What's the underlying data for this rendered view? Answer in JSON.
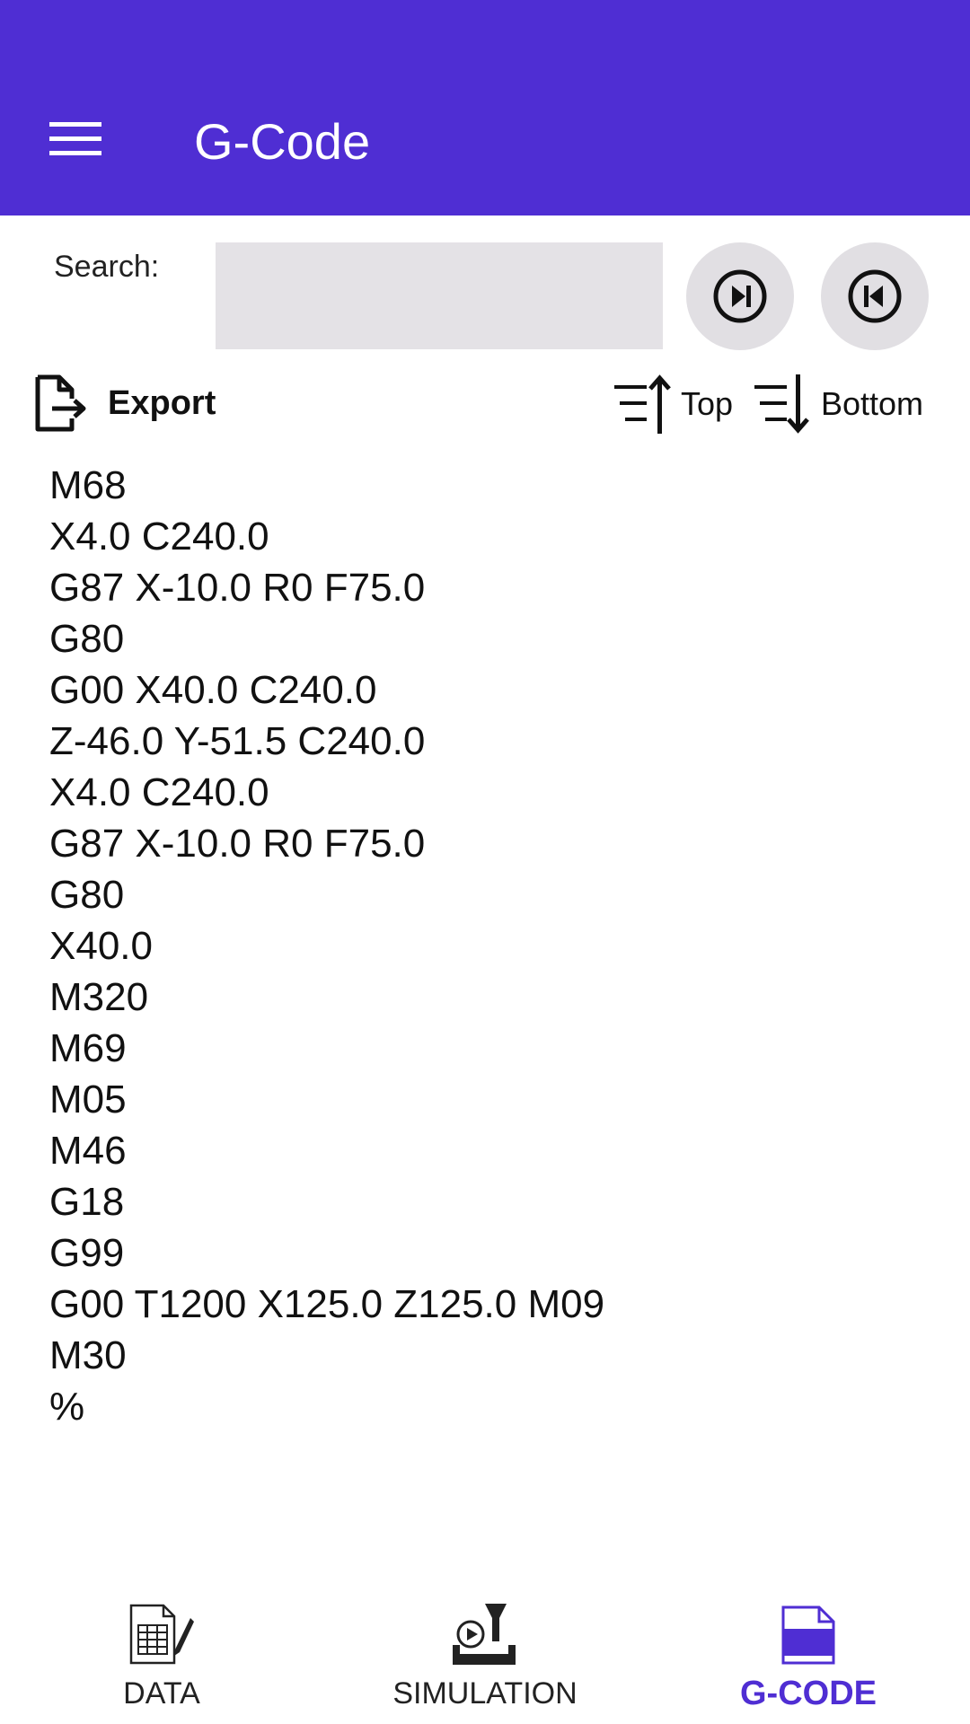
{
  "app_bar": {
    "title": "G-Code",
    "background": "#4f2ed3",
    "menu_icon": "hamburger-menu-icon"
  },
  "search": {
    "label": "Search:",
    "value": "",
    "placeholder": "",
    "next_icon": "skip-next-icon",
    "prev_icon": "skip-previous-icon"
  },
  "toolbar": {
    "export_label": "Export",
    "export_icon": "file-export-icon",
    "top_label": "Top",
    "top_icon": "sort-up-arrow-icon",
    "bottom_label": "Bottom",
    "bottom_icon": "sort-down-arrow-icon"
  },
  "gcode_lines": [
    "M68",
    "X4.0 C240.0",
    "G87 X-10.0 R0 F75.0",
    "G80",
    "G00 X40.0 C240.0",
    "Z-46.0 Y-51.5 C240.0",
    "X4.0 C240.0",
    "G87 X-10.0 R0 F75.0",
    "G80",
    "X40.0",
    "M320",
    "M69",
    "M05",
    "M46",
    "G18",
    "G99",
    "G00 T1200 X125.0 Z125.0 M09",
    "M30",
    "%"
  ],
  "bottom_nav": {
    "tabs": [
      {
        "label": "DATA",
        "icon": "spreadsheet-edit-icon",
        "active": false
      },
      {
        "label": "SIMULATION",
        "icon": "machine-simulation-icon",
        "active": false
      },
      {
        "label": "G-CODE",
        "icon": "document-icon",
        "active": true
      }
    ],
    "active_color": "#4f2ed3"
  }
}
